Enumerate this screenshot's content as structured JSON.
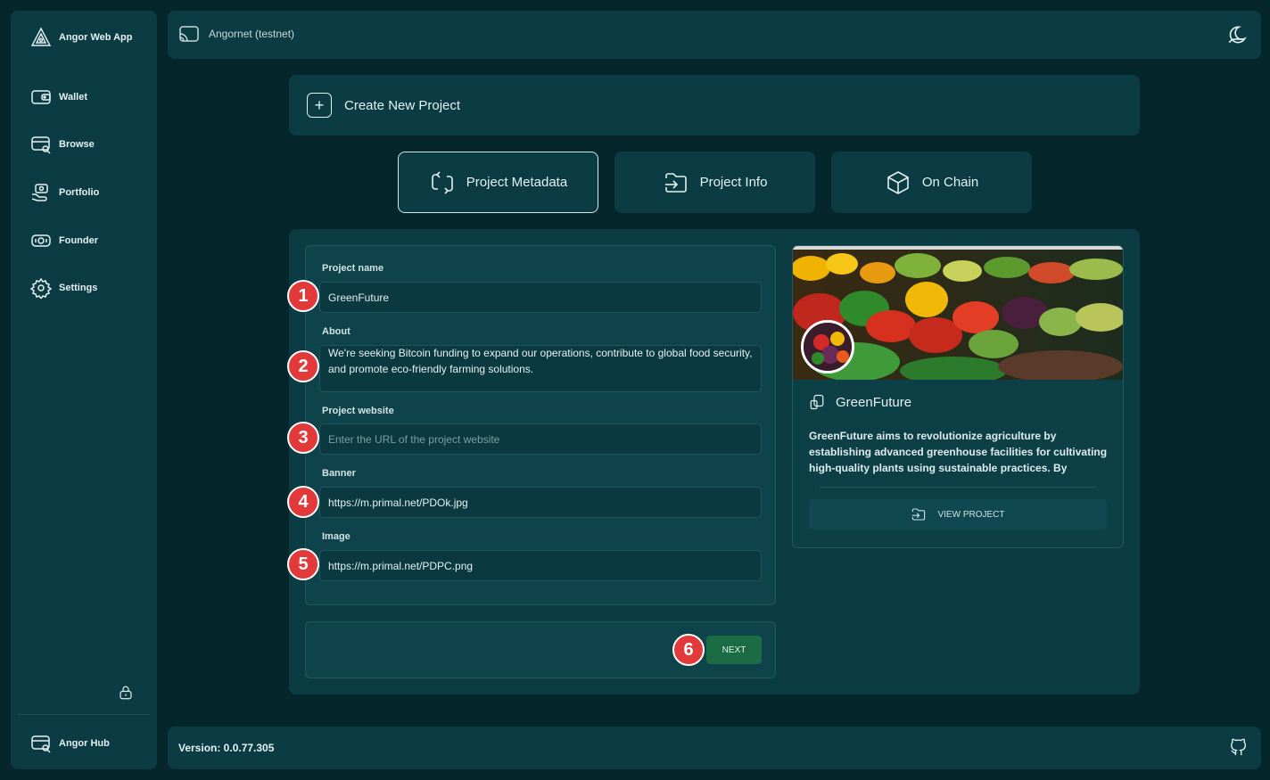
{
  "app": {
    "name": "Angor Web App"
  },
  "sidebar": {
    "items": [
      {
        "label": "Wallet",
        "icon": "wallet-icon"
      },
      {
        "label": "Browse",
        "icon": "browse-icon"
      },
      {
        "label": "Portfolio",
        "icon": "portfolio-icon"
      },
      {
        "label": "Founder",
        "icon": "founder-icon"
      },
      {
        "label": "Settings",
        "icon": "gear-icon"
      }
    ],
    "hub_label": "Angor Hub"
  },
  "header": {
    "network": "Angornet (testnet)"
  },
  "create": {
    "title": "Create New Project"
  },
  "tabs": [
    {
      "label": "Project Metadata",
      "active": true
    },
    {
      "label": "Project Info",
      "active": false
    },
    {
      "label": "On Chain",
      "active": false
    }
  ],
  "form": {
    "name_label": "Project name",
    "name_value": "GreenFuture",
    "about_label": "About",
    "about_value": "GreenFuture aims to revolutionize agriculture by establishing advanced greenhouse facilities for cultivating high-quality plants using sustainable practices. By leveraging cutting-edge technology, we ensure optimal growth conditions and efficient resource use. We're seeking Bitcoin funding to expand our operations, contribute to global food security, and promote eco-friendly farming solutions.",
    "website_label": "Project website",
    "website_placeholder": "Enter the URL of the project website",
    "banner_label": "Banner",
    "banner_value": "https://m.primal.net/PDOk.jpg",
    "image_label": "Image",
    "image_value": "https://m.primal.net/PDPC.png",
    "next_label": "NEXT"
  },
  "markers": [
    "1",
    "2",
    "3",
    "4",
    "5",
    "6"
  ],
  "preview": {
    "title": "GreenFuture",
    "description": "GreenFuture aims to revolutionize agriculture by establishing advanced greenhouse facilities for cultivating high-quality plants using sustainable practices. By leveraging cutting-edg...",
    "view_label": "VIEW PROJECT"
  },
  "footer": {
    "version": "Version: 0.0.77.305"
  },
  "colors": {
    "background": "#05272c",
    "panel": "#0b3b43",
    "accent": "#1b6b44",
    "marker": "#e23a3a"
  }
}
